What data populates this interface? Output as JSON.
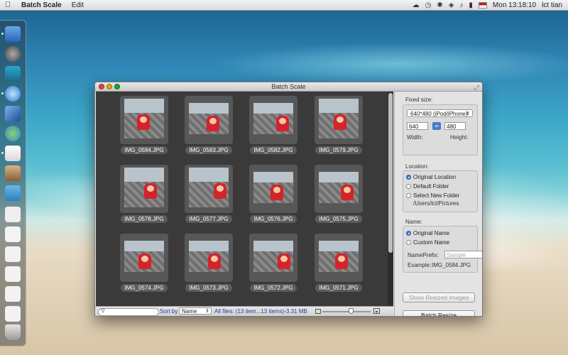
{
  "menubar": {
    "app_name": "Batch Scale",
    "menus": [
      "Edit"
    ],
    "clock": "Mon 13:18:10",
    "user": "lct tian"
  },
  "window": {
    "title": "Batch Scale"
  },
  "images": [
    {
      "name": "IMG_0584.JPG"
    },
    {
      "name": "IMG_0583.JPG"
    },
    {
      "name": "IMG_0582.JPG"
    },
    {
      "name": "IMG_0579.JPG"
    },
    {
      "name": "IMG_0578.JPG"
    },
    {
      "name": "IMG_0577.JPG"
    },
    {
      "name": "IMG_0576.JPG"
    },
    {
      "name": "IMG_0575.JPG"
    },
    {
      "name": "IMG_0574.JPG"
    },
    {
      "name": "IMG_0573.JPG"
    },
    {
      "name": "IMG_0572.JPG"
    },
    {
      "name": "IMG_0571.JPG"
    }
  ],
  "bottom_bar": {
    "search_placeholder": "",
    "sort_label": "Sort by",
    "sort_value": "Name",
    "file_summary": "All files: (13 item...13 items)-3.31 MB",
    "zoom_level": 0.6
  },
  "panel": {
    "fixed_size": {
      "label": "Fixed size:",
      "preset": "640*480 (iPod/iPhone)",
      "width_value": "640",
      "height_value": "480",
      "width_label": "Width:",
      "height_label": "Height:"
    },
    "location": {
      "label": "Location:",
      "options": [
        "Original Location",
        "Default Folder",
        "Select New Folder"
      ],
      "selected": "Original Location",
      "path": "/Users/lct/Pictures"
    },
    "name": {
      "label": "Name:",
      "options": [
        "Original Name",
        "Custom Name"
      ],
      "selected": "Original Name",
      "prefix_label": "NamePrefix:",
      "prefix_placeholder": "Sample",
      "example_label": "Example:",
      "example_value": "IMG_0584.JPG"
    },
    "show_button": "Show Resized Images",
    "batch_button": "Batch Resize"
  },
  "colors": {
    "grid_background": "#3a3a3a",
    "accent_blue": "#3d7bd8",
    "shirt_red": "#d4232a"
  },
  "icons": {
    "menubar": [
      "apple-icon",
      "cloud-icon",
      "time-machine-icon",
      "bluetooth-icon",
      "wifi-icon",
      "volume-icon",
      "battery-icon",
      "flag-icon",
      "user-icon"
    ],
    "dock": [
      "finder-icon",
      "launchpad-icon",
      "dashboard-icon",
      "safari-icon",
      "xcode-icon",
      "messenger-icon",
      "textedit-icon",
      "photo-icon",
      "folder-icon",
      "document-icon",
      "trash-icon"
    ]
  }
}
